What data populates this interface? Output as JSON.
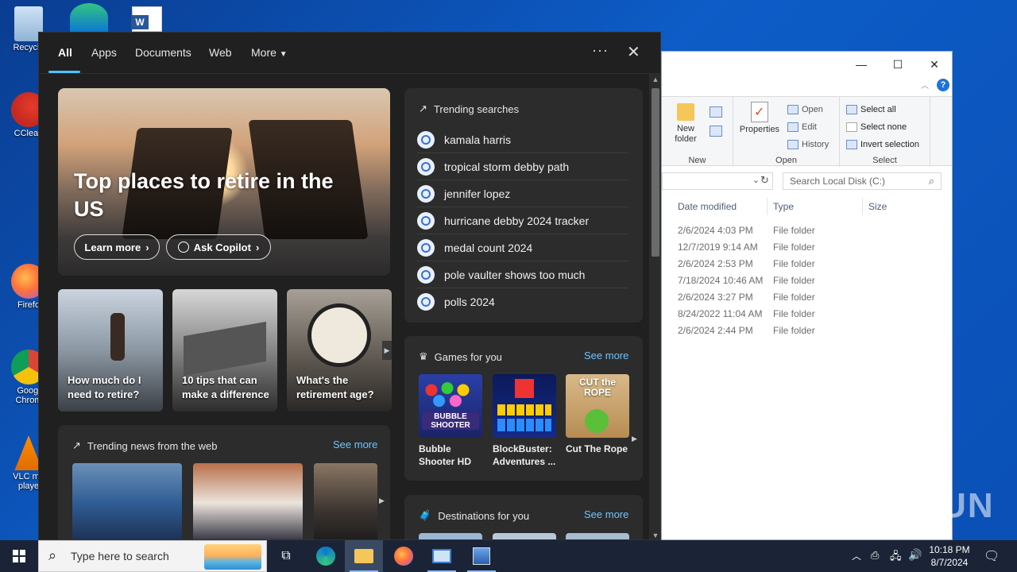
{
  "desktop": {
    "icons": [
      {
        "label": "Recycle"
      },
      {
        "label": "CClean"
      },
      {
        "label": "Firefo"
      },
      {
        "label": "Googl Chrom"
      },
      {
        "label": "VLC me playe"
      }
    ]
  },
  "explorer": {
    "ribbon": {
      "new_folder": "New folder",
      "new_label": "New",
      "properties": "Properties",
      "open": "Open",
      "edit": "Edit",
      "history": "History",
      "open_label": "Open",
      "select_all": "Select all",
      "select_none": "Select none",
      "invert_selection": "Invert selection",
      "select_label": "Select"
    },
    "search_placeholder": "Search Local Disk (C:)",
    "columns": {
      "date": "Date modified",
      "type": "Type",
      "size": "Size"
    },
    "rows": [
      {
        "date": "2/6/2024 4:03 PM",
        "type": "File folder"
      },
      {
        "date": "12/7/2019 9:14 AM",
        "type": "File folder"
      },
      {
        "date": "2/6/2024 2:53 PM",
        "type": "File folder"
      },
      {
        "date": "7/18/2024 10:46 AM",
        "type": "File folder"
      },
      {
        "date": "2/6/2024 3:27 PM",
        "type": "File folder"
      },
      {
        "date": "8/24/2022 11:04 AM",
        "type": "File folder"
      },
      {
        "date": "2/6/2024 2:44 PM",
        "type": "File folder"
      }
    ]
  },
  "flyout": {
    "tabs": [
      "All",
      "Apps",
      "Documents",
      "Web",
      "More"
    ],
    "more_dots": "···",
    "close": "✕",
    "hero": {
      "title": "Top places to retire in the US",
      "learn_more": "Learn more",
      "ask_copilot": "Ask Copilot"
    },
    "tiles": [
      {
        "caption": "How much do I need to retire?"
      },
      {
        "caption": "10 tips that can make a difference"
      },
      {
        "caption": "What's the retirement age?"
      }
    ],
    "news": {
      "title": "Trending news from the web",
      "see_more": "See more"
    },
    "trending": {
      "title": "Trending searches",
      "items": [
        "kamala harris",
        "tropical storm debby path",
        "jennifer lopez",
        "hurricane debby 2024 tracker",
        "medal count 2024",
        "pole vaulter shows too much",
        "polls 2024"
      ]
    },
    "games": {
      "title": "Games for you",
      "see_more": "See more",
      "items": [
        {
          "name": "Bubble Shooter HD",
          "art": "BUBBLE SHOOTER"
        },
        {
          "name": "BlockBuster: Adventures ..."
        },
        {
          "name": "Cut The Rope",
          "art": "CUT the ROPE"
        }
      ]
    },
    "destinations": {
      "title": "Destinations for you",
      "see_more": "See more"
    }
  },
  "taskbar": {
    "search_placeholder": "Type here to search",
    "time": "10:18 PM",
    "date": "8/7/2024"
  },
  "watermark": "ANY RUN"
}
